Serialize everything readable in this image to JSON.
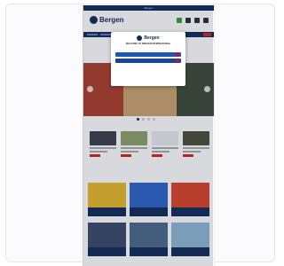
{
  "phone": {
    "top_strip_text": "Bergen",
    "logo_text": "Bergen",
    "nav_items": [
      "",
      "",
      "",
      "",
      "",
      "",
      ""
    ],
    "sections": {
      "products": "",
      "offers": ""
    }
  },
  "modal": {
    "logo_text": "Bergen",
    "title": "WELCOME TO BERGEN INTERNATIONAL",
    "description": "",
    "option_1": "",
    "option_2": "",
    "note": "",
    "link": ""
  },
  "colors": {
    "brand": "#0e2a5a",
    "accent": "#1e56b5",
    "sale": "#d72020",
    "cart": "#26a82e"
  }
}
